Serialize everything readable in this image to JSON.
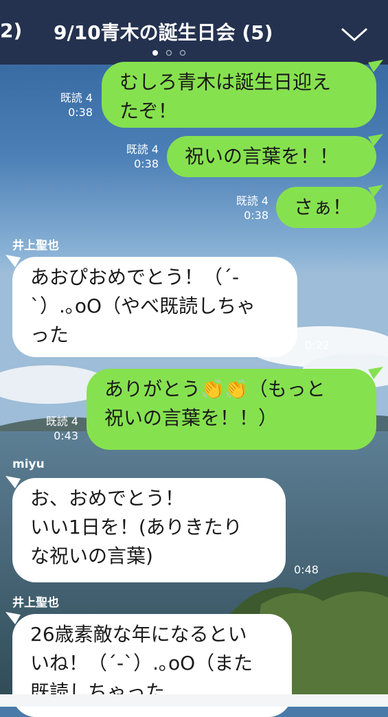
{
  "header": {
    "back_label": "2)",
    "title": "9/10青木の誕生日会 (5)",
    "page_dots": 3,
    "active_dot": 0
  },
  "messages": [
    {
      "type": "sent",
      "read": "既読 4",
      "time": "0:38",
      "lines": [
        "むしろ青木は誕生日迎え",
        "たぞ！"
      ]
    },
    {
      "type": "sent",
      "read": "既読 4",
      "time": "0:38",
      "lines": [
        "祝いの言葉を！！"
      ]
    },
    {
      "type": "sent",
      "read": "既読 4",
      "time": "0:38",
      "lines": [
        "さぁ！"
      ]
    },
    {
      "type": "received",
      "sender": "井上聖也",
      "time": "0:22",
      "lines": [
        "あおぴおめでとう！（´-",
        "`）.｡oO（やべ既読しちゃ",
        "った"
      ]
    },
    {
      "type": "sent",
      "read": "既読 4",
      "time": "0:43",
      "lines": [
        "ありがとう👏👏（もっと",
        "祝いの言葉を！！）"
      ]
    },
    {
      "type": "received",
      "sender": "miyu",
      "time": "0:48",
      "lines": [
        "お、おめでとう！",
        "いい1日を！(ありきたり",
        "な祝いの言葉)"
      ]
    },
    {
      "type": "received",
      "sender": "井上聖也",
      "time": "",
      "lines": [
        "26歳素敵な年になるとい",
        "いね！（´-`）.｡oO（また",
        "既読しちゃった"
      ]
    }
  ],
  "colors": {
    "header_bg": "#243250",
    "sent_bubble": "#86e14f",
    "received_bubble": "#ffffff"
  }
}
